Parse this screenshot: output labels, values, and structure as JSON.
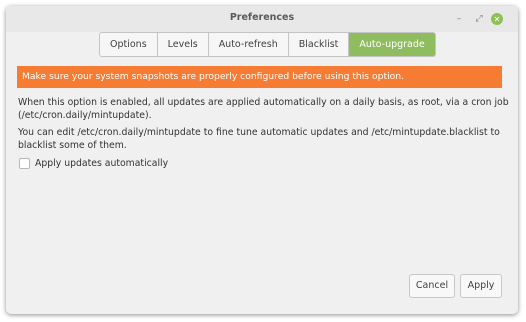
{
  "window": {
    "title": "Preferences",
    "minimize_glyph": "–",
    "maximize_glyph": "⤢",
    "close_glyph": "✕"
  },
  "tabs": [
    {
      "label": "Options",
      "active": false
    },
    {
      "label": "Levels",
      "active": false
    },
    {
      "label": "Auto-refresh",
      "active": false
    },
    {
      "label": "Blacklist",
      "active": false
    },
    {
      "label": "Auto-upgrade",
      "active": true
    }
  ],
  "warning": {
    "text": "Make sure your system snapshots are properly configured before using this option.",
    "color": "#f57c32"
  },
  "description": [
    "When this option is enabled, all updates are applied automatically on a daily basis, as root, via a cron job (/etc/cron.daily/mintupdate).",
    "You can edit /etc/cron.daily/mintupdate to fine tune automatic updates and /etc/mintupdate.blacklist to blacklist some of them."
  ],
  "option": {
    "label": "Apply updates automatically",
    "checked": false
  },
  "buttons": {
    "cancel": "Cancel",
    "apply": "Apply"
  },
  "colors": {
    "accent": "#8fbc5e",
    "close_button": "#8dc153"
  }
}
